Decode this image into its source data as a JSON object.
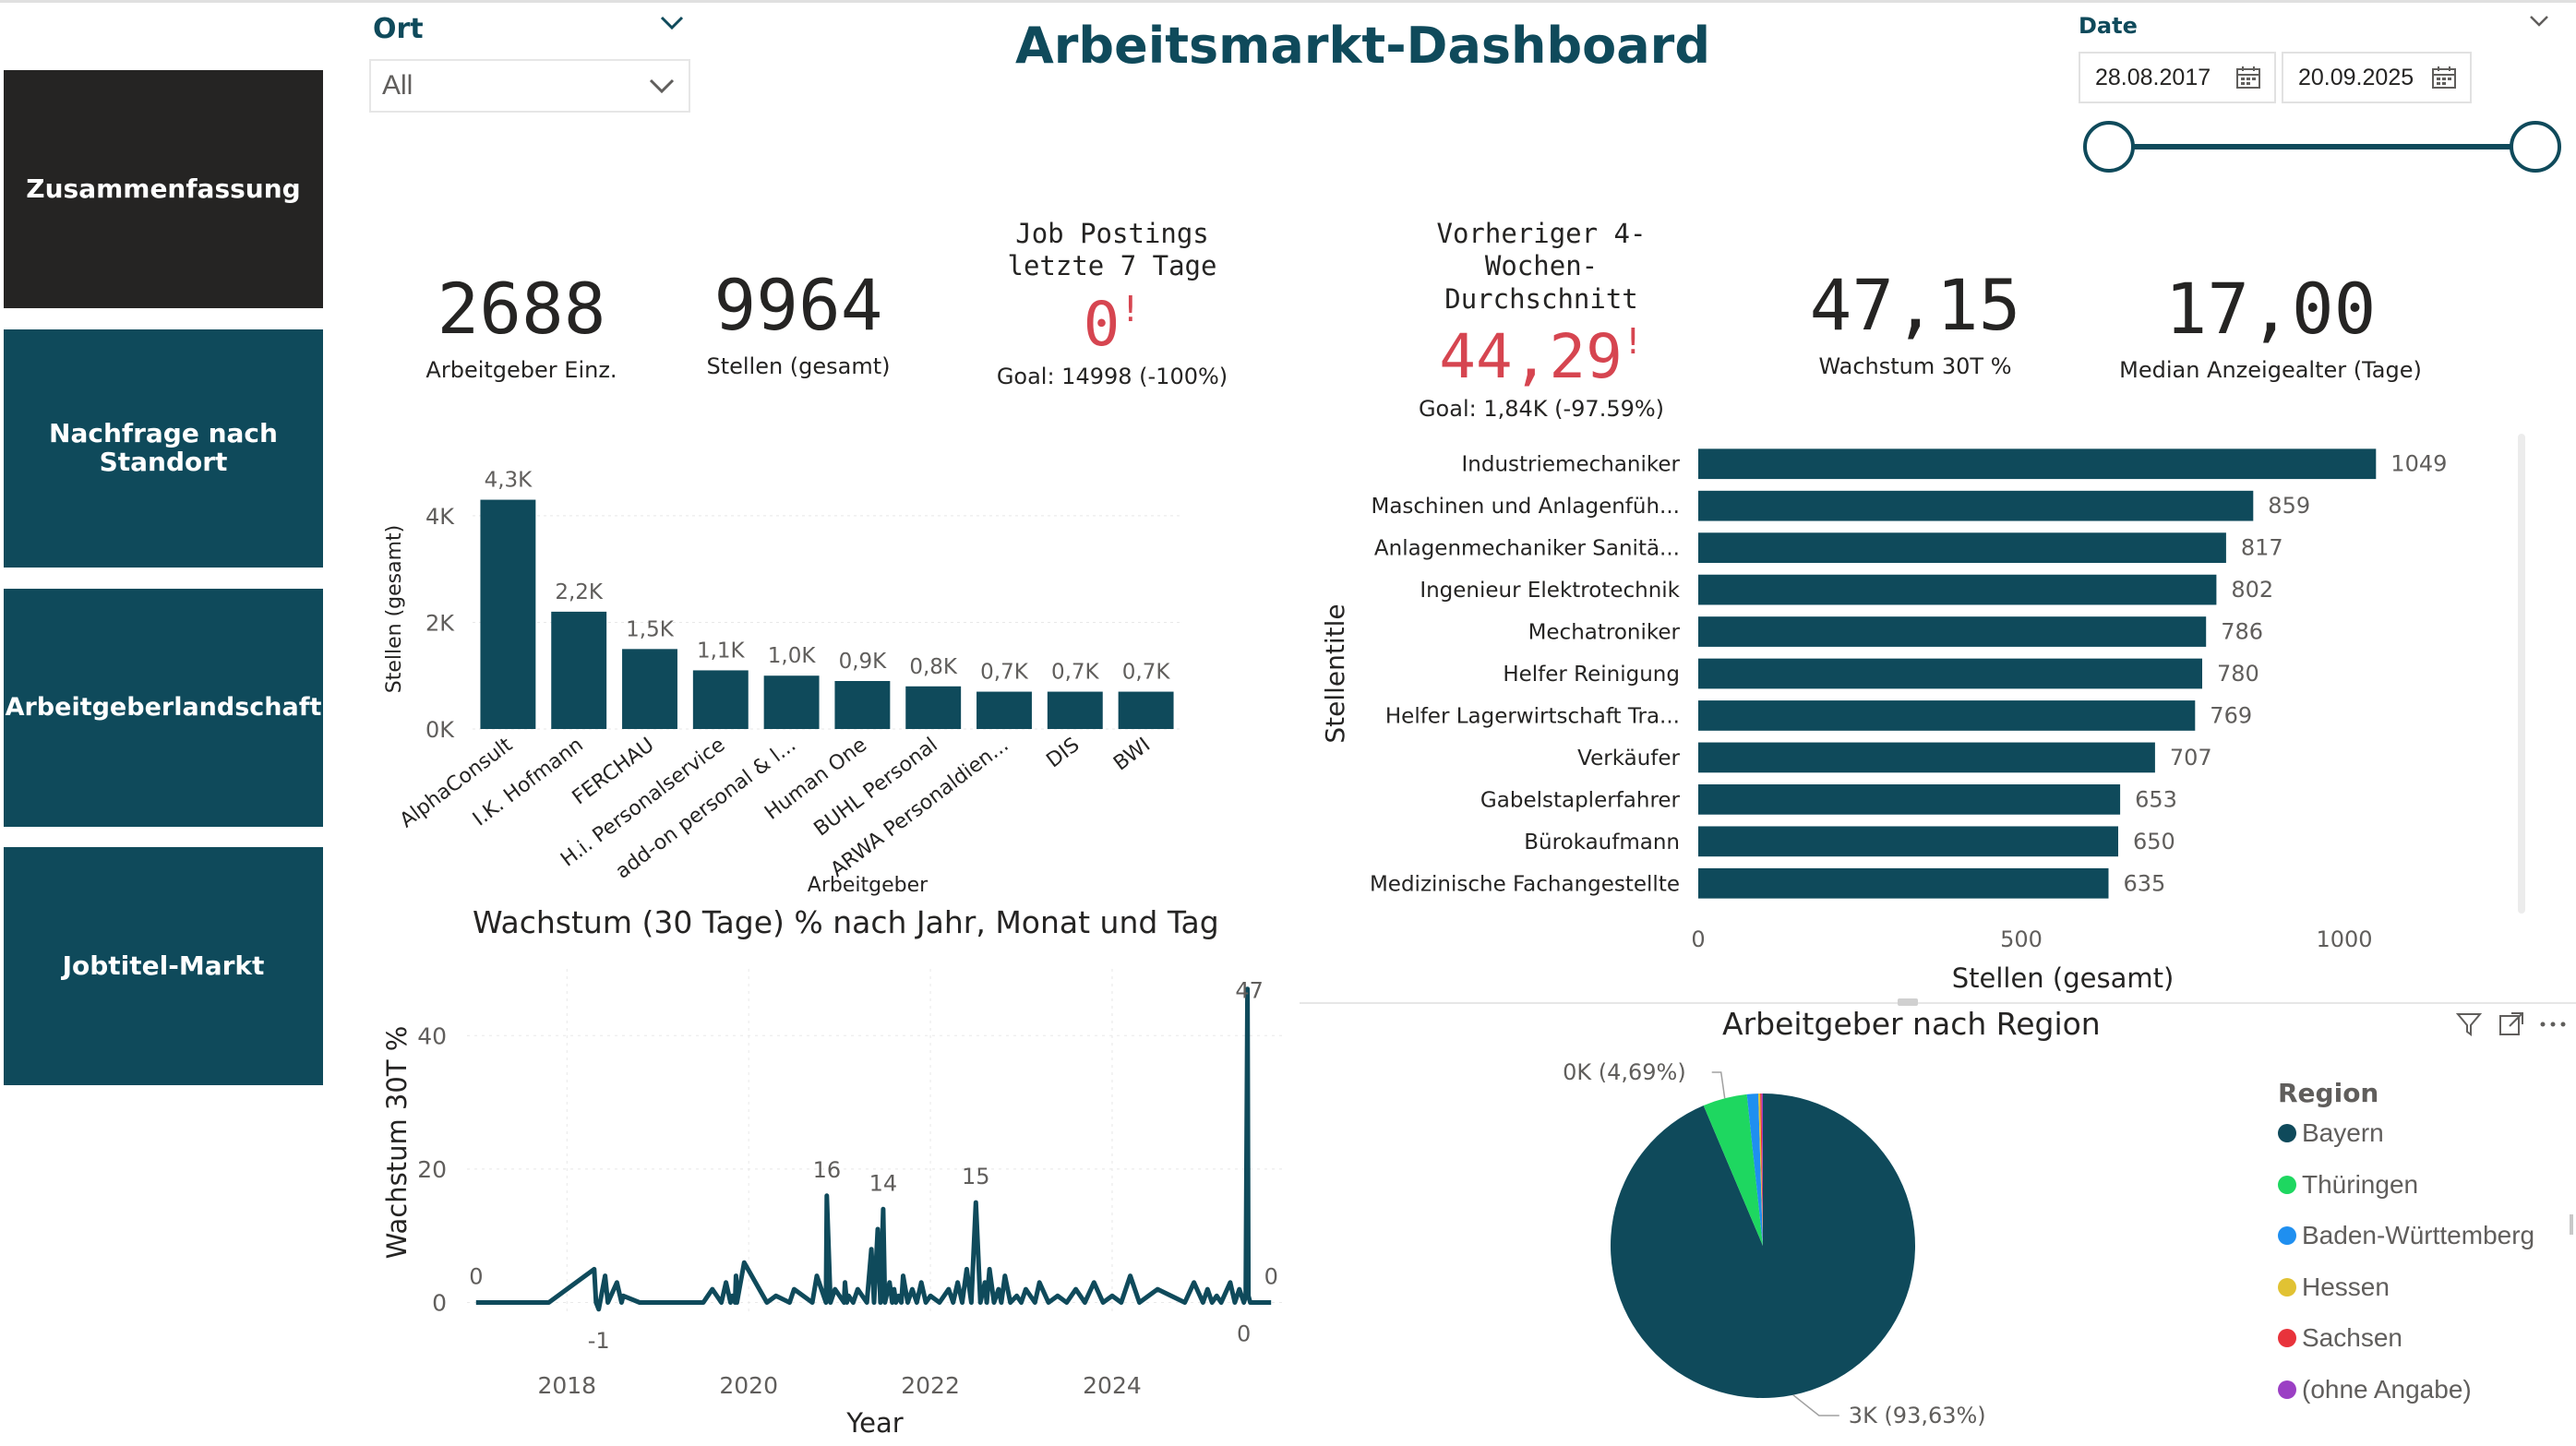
{
  "title": "Arbeitsmarkt-Dashboard",
  "nav": {
    "items": [
      {
        "label": "Zusammenfassung",
        "active": true
      },
      {
        "label": "Nachfrage nach Standort",
        "active": false
      },
      {
        "label": "Arbeitgeberlandschaft",
        "active": false
      },
      {
        "label": "Jobtitel-Markt",
        "active": false
      }
    ]
  },
  "filters": {
    "ort": {
      "label": "Ort",
      "value": "All"
    },
    "date": {
      "label": "Date",
      "start": "28.08.2017",
      "end": "20.09.2025"
    }
  },
  "kpis": {
    "arbeitgeber": {
      "value": "2688",
      "label": "Arbeitgeber Einz."
    },
    "stellen": {
      "value": "9964",
      "label": "Stellen (gesamt)"
    },
    "postings7": {
      "title": "Job Postings letzte 7 Tage",
      "value": "0",
      "alert": "!",
      "goal": "Goal: 14998 (-100%)"
    },
    "prev4w": {
      "title": "Vorheriger 4-Wochen-Durchschnitt",
      "value": "44,29",
      "alert": "!",
      "goal": "Goal: 1,84K (-97.59%)"
    },
    "wachstum": {
      "value": "47,15",
      "label": "Wachstum 30T %"
    },
    "median": {
      "value": "17,00",
      "label": "Median Anzeigealter (Tage)"
    }
  },
  "colors": {
    "primary": "#0f4a5b",
    "nav_active": "#252423",
    "alert": "#d64550",
    "gridline": "#e8e8e8"
  },
  "icons": {
    "calendar": "calendar-icon",
    "chevron": "chevron-down-icon",
    "filter": "filter-icon",
    "focus": "focus-mode-icon",
    "more": "more-options-icon"
  },
  "chart_data": [
    {
      "id": "employers",
      "type": "bar",
      "xlabel": "Arbeitgeber",
      "ylabel": "Stellen (gesamt)",
      "ylim": [
        0,
        4500
      ],
      "ticks": [
        0,
        2000,
        4000
      ],
      "tick_labels": [
        "0K",
        "2K",
        "4K"
      ],
      "categories": [
        "AlphaConsult",
        "I.K. Hofmann",
        "FERCHAU",
        "H.i. Personalservice",
        "add-on personal & l...",
        "Human One",
        "BUHL Personal",
        "ARWA Personaldien...",
        "DIS",
        "BWI"
      ],
      "values": [
        4300,
        2200,
        1500,
        1100,
        1000,
        900,
        800,
        700,
        700,
        700
      ],
      "data_labels": [
        "4,3K",
        "2,2K",
        "1,5K",
        "1,1K",
        "1,0K",
        "0,9K",
        "0,8K",
        "0,7K",
        "0,7K",
        "0,7K"
      ]
    },
    {
      "id": "jobtitles",
      "type": "bar",
      "orientation": "horizontal",
      "xlabel": "Stellen (gesamt)",
      "ylabel": "Stellentitle",
      "xlim": [
        0,
        1100
      ],
      "ticks": [
        0,
        500,
        1000
      ],
      "categories": [
        "Industriemechaniker",
        "Maschinen und Anlagenfüh...",
        "Anlagenmechaniker Sanitä...",
        "Ingenieur Elektrotechnik",
        "Mechatroniker",
        "Helfer Reinigung",
        "Helfer Lagerwirtschaft Tra...",
        "Verkäufer",
        "Gabelstaplerfahrer",
        "Bürokaufmann",
        "Medizinische Fachangestellte"
      ],
      "values": [
        1049,
        859,
        817,
        802,
        786,
        780,
        769,
        707,
        653,
        650,
        635
      ]
    },
    {
      "id": "growth",
      "type": "line",
      "title": "Wachstum (30 Tage) % nach Jahr, Monat und Tag",
      "xlabel": "Year",
      "ylabel": "Wachstum 30T %",
      "xlim": [
        2016.9,
        2025.9
      ],
      "ylim": [
        -2,
        50
      ],
      "xticks": [
        2018,
        2020,
        2022,
        2024
      ],
      "yticks": [
        0,
        20,
        40
      ],
      "x": [
        2017.0,
        2017.8,
        2018.3,
        2018.32,
        2018.35,
        2018.42,
        2018.45,
        2018.55,
        2018.6,
        2018.62,
        2018.8,
        2019.5,
        2019.6,
        2019.7,
        2019.75,
        2019.8,
        2019.82,
        2019.85,
        2019.86,
        2019.87,
        2019.95,
        2020.2,
        2020.3,
        2020.45,
        2020.5,
        2020.7,
        2020.75,
        2020.85,
        2020.86,
        2020.9,
        2020.95,
        2021.05,
        2021.06,
        2021.08,
        2021.1,
        2021.15,
        2021.2,
        2021.3,
        2021.35,
        2021.38,
        2021.42,
        2021.45,
        2021.48,
        2021.5,
        2021.55,
        2021.58,
        2021.6,
        2021.62,
        2021.65,
        2021.68,
        2021.7,
        2021.75,
        2021.8,
        2021.85,
        2021.9,
        2021.95,
        2022.0,
        2022.1,
        2022.2,
        2022.25,
        2022.3,
        2022.35,
        2022.4,
        2022.45,
        2022.5,
        2022.55,
        2022.6,
        2022.62,
        2022.65,
        2022.7,
        2022.75,
        2022.78,
        2022.82,
        2022.88,
        2022.95,
        2023.0,
        2023.05,
        2023.15,
        2023.2,
        2023.3,
        2023.4,
        2023.5,
        2023.6,
        2023.7,
        2023.8,
        2023.9,
        2024.0,
        2024.1,
        2024.2,
        2024.3,
        2024.5,
        2024.8,
        2024.9,
        2025.0,
        2025.05,
        2025.1,
        2025.15,
        2025.2,
        2025.3,
        2025.35,
        2025.4,
        2025.45,
        2025.47,
        2025.49,
        2025.5,
        2025.52,
        2025.55,
        2025.75
      ],
      "y": [
        0,
        0,
        5,
        0,
        -1,
        4,
        0,
        3,
        0,
        1,
        0,
        0,
        2,
        0,
        3,
        0,
        1,
        0,
        4,
        0,
        6,
        0,
        1,
        0,
        2,
        0,
        4,
        0,
        16,
        0,
        2,
        0,
        3,
        0,
        1,
        0,
        2,
        0,
        8,
        0,
        11,
        0,
        14,
        0,
        3,
        0,
        2,
        0,
        1,
        0,
        4,
        0,
        2,
        0,
        3,
        0,
        1,
        0,
        2,
        0,
        3,
        0,
        5,
        0,
        15,
        0,
        3,
        0,
        5,
        0,
        2,
        0,
        4,
        0,
        1,
        0,
        2,
        0,
        3,
        0,
        1,
        0,
        2,
        0,
        3,
        0,
        1,
        0,
        4,
        0,
        2,
        0,
        3,
        0,
        2,
        0,
        1,
        0,
        3,
        0,
        2,
        0,
        1,
        47,
        1,
        0,
        0,
        0
      ],
      "annotations": [
        {
          "x": 2017.0,
          "y": 0,
          "label": "0",
          "pos": "above"
        },
        {
          "x": 2018.35,
          "y": -1,
          "label": "-1",
          "pos": "below"
        },
        {
          "x": 2020.86,
          "y": 16,
          "label": "16",
          "pos": "above"
        },
        {
          "x": 2021.48,
          "y": 14,
          "label": "14",
          "pos": "above"
        },
        {
          "x": 2022.5,
          "y": 15,
          "label": "15",
          "pos": "above"
        },
        {
          "x": 2025.49,
          "y": 47,
          "label": "47",
          "pos": "inline"
        },
        {
          "x": 2025.45,
          "y": 0,
          "label": "0",
          "pos": "below"
        },
        {
          "x": 2025.75,
          "y": 0,
          "label": "0",
          "pos": "above"
        }
      ]
    },
    {
      "id": "region",
      "type": "pie",
      "title": "Arbeitgeber nach Region",
      "legend_title": "Region",
      "series": [
        {
          "name": "Bayern",
          "value": 93.63,
          "color": "#0f4a5b",
          "label": "3K (93,63%)"
        },
        {
          "name": "Thüringen",
          "value": 4.69,
          "color": "#1ed760",
          "label": "0K (4,69%)"
        },
        {
          "name": "Baden-Württemberg",
          "value": 1.2,
          "color": "#1f8ff0"
        },
        {
          "name": "Hessen",
          "value": 0.2,
          "color": "#e1c233"
        },
        {
          "name": "Sachsen",
          "value": 0.15,
          "color": "#e8333b"
        },
        {
          "name": "(ohne Angabe)",
          "value": 0.13,
          "color": "#9b3fc4"
        }
      ]
    }
  ]
}
